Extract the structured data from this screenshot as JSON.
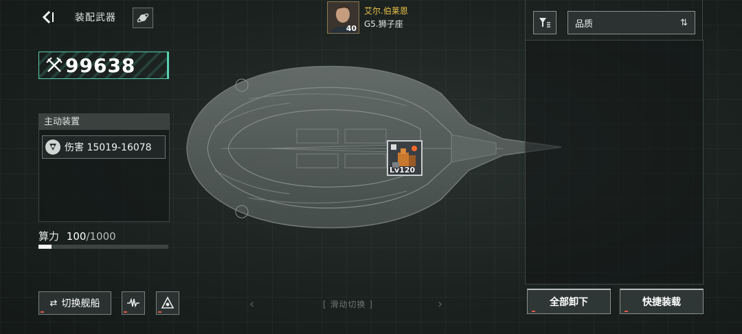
{
  "header": {
    "title": "装配武器"
  },
  "power": {
    "value": "99638"
  },
  "active_device": {
    "title": "主动装置",
    "items": [
      {
        "label": "伤害 15019-16078"
      }
    ]
  },
  "compute": {
    "label": "算力",
    "current": "100",
    "max": "/1000",
    "fraction": 0.1
  },
  "bottom_left": {
    "switch_ship_label": "切换舰船"
  },
  "swipe": {
    "label": "[ 滑动切换 ]"
  },
  "weapon_slot": {
    "level": "Lv120"
  },
  "pilot": {
    "name": "艾尔.伯莱恩",
    "rank": "G5.狮子座",
    "level": "40"
  },
  "right_panel": {
    "sort_label": "品质",
    "unequip_all_label": "全部卸下",
    "quick_equip_label": "快捷装载"
  },
  "icons": {
    "back": "back-arrow-icon",
    "planet": "planet-icon",
    "power": "crossed-swords-icon",
    "filter": "filter-icon",
    "sort": "sort-arrows-icon"
  },
  "colors": {
    "accent": "#58d3b2",
    "pilot_name": "#f0c44a"
  }
}
